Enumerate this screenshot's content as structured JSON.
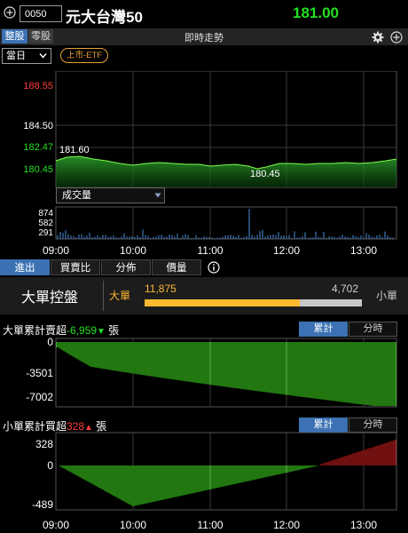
{
  "header": {
    "plus_icon": "plus-circle-icon",
    "code_value": "0050",
    "stock_name": "元大台灣50",
    "price": "181.00",
    "price_color": "#22e022"
  },
  "tabs": {
    "whole_lot": "整股",
    "odd_lot": "零股",
    "title": "即時走勢",
    "settings_icon": "gear-icon",
    "add_icon": "plus-circle-icon"
  },
  "controls": {
    "period": "當日",
    "listing_badge": "上市-ETF"
  },
  "price_chart": {
    "y_labels": [
      {
        "text": "188.55",
        "value": 188.55,
        "color": "#ff3b3b"
      },
      {
        "text": "184.50",
        "value": 184.5,
        "color": "#ffffff"
      },
      {
        "text": "182.47",
        "value": 182.47,
        "color": "#22e022"
      },
      {
        "text": "180.45",
        "value": 180.45,
        "color": "#22e022"
      }
    ],
    "high_annotation": "181.60",
    "low_annotation": "180.45"
  },
  "volume": {
    "selector_label": "成交量",
    "y_labels": [
      "874",
      "582",
      "291"
    ]
  },
  "time_axis": [
    "09:00",
    "10:00",
    "11:00",
    "12:00",
    "13:00"
  ],
  "bottom_tabs": [
    "進出",
    "買賣比",
    "分佈",
    "價量"
  ],
  "big_order": {
    "title": "大單控盤",
    "big_label": "大單",
    "big_value": "11,875",
    "small_value": "4,702",
    "small_label": "小單",
    "big_share": 0.716,
    "big_color": "#ffb830"
  },
  "big_cumulative": {
    "title_prefix": "大單累計賣超",
    "value": "-6,959",
    "unit": "張",
    "toggle_cumulative": "累計",
    "toggle_period": "分時",
    "y_labels": [
      "0",
      "-3501",
      "-7002"
    ],
    "bar_color": "#44ee22"
  },
  "small_cumulative": {
    "title_prefix": "小單累計買超",
    "value": "328",
    "unit": "張",
    "toggle_cumulative": "累計",
    "toggle_period": "分時",
    "y_labels": [
      "328",
      "0",
      "-489"
    ],
    "pos_color": "#e02020",
    "neg_color": "#44ee22"
  }
}
